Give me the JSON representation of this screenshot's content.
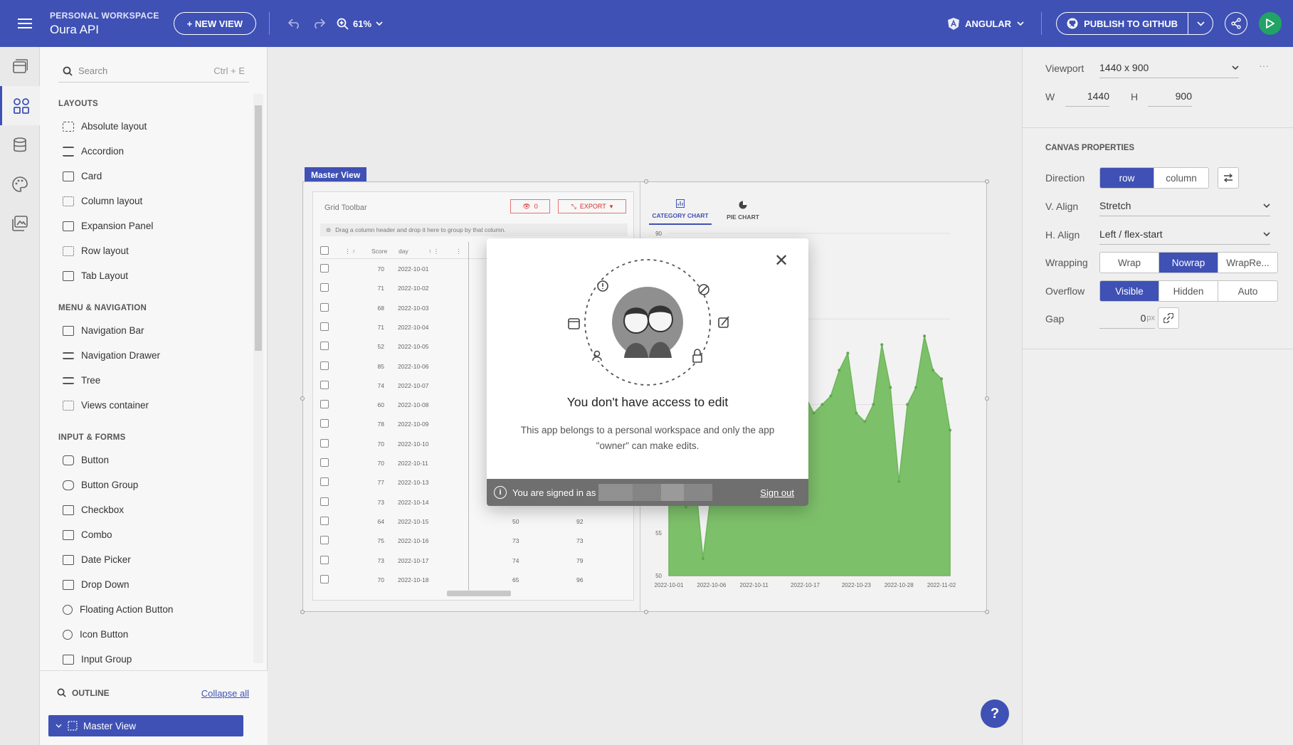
{
  "header": {
    "workspace_label": "PERSONAL WORKSPACE",
    "app_name": "Oura API",
    "new_view_label": "+ NEW VIEW",
    "zoom": "61%",
    "framework": "ANGULAR",
    "publish_label": "PUBLISH TO GITHUB"
  },
  "toolbox": {
    "search_placeholder": "Search",
    "search_shortcut": "Ctrl + E",
    "sections": [
      {
        "title": "LAYOUTS",
        "items": [
          "Absolute layout",
          "Accordion",
          "Card",
          "Column layout",
          "Expansion Panel",
          "Row layout",
          "Tab Layout"
        ]
      },
      {
        "title": "MENU & NAVIGATION",
        "items": [
          "Navigation Bar",
          "Navigation Drawer",
          "Tree",
          "Views container"
        ]
      },
      {
        "title": "INPUT & FORMS",
        "items": [
          "Button",
          "Button Group",
          "Checkbox",
          "Combo",
          "Date Picker",
          "Drop Down",
          "Floating Action Button",
          "Icon Button",
          "Input Group"
        ]
      }
    ],
    "outline_label": "OUTLINE",
    "collapse_all": "Collapse all",
    "outline_item": "Master View"
  },
  "canvas": {
    "master_view_tag": "Master View",
    "grid": {
      "toolbar_title": "Grid Toolbar",
      "hidden_count": "0",
      "export_label": "EXPORT",
      "group_hint": "Drag a column header and drop it here to group by that column.",
      "col_score": "Score",
      "col_day": "day",
      "rows": [
        {
          "score": "70",
          "day": "2022-10-01"
        },
        {
          "score": "71",
          "day": "2022-10-02"
        },
        {
          "score": "68",
          "day": "2022-10-03"
        },
        {
          "score": "71",
          "day": "2022-10-04"
        },
        {
          "score": "52",
          "day": "2022-10-05"
        },
        {
          "score": "85",
          "day": "2022-10-06"
        },
        {
          "score": "74",
          "day": "2022-10-07"
        },
        {
          "score": "60",
          "day": "2022-10-08"
        },
        {
          "score": "78",
          "day": "2022-10-09"
        },
        {
          "score": "70",
          "day": "2022-10-10"
        },
        {
          "score": "70",
          "day": "2022-10-11"
        },
        {
          "score": "77",
          "day": "2022-10-13"
        },
        {
          "score": "73",
          "day": "2022-10-14"
        },
        {
          "score": "64",
          "day": "2022-10-15",
          "c3": "50",
          "c4": "92"
        },
        {
          "score": "75",
          "day": "2022-10-16",
          "c3": "73",
          "c4": "73"
        },
        {
          "score": "73",
          "day": "2022-10-17",
          "c3": "74",
          "c4": "79"
        },
        {
          "score": "70",
          "day": "2022-10-18",
          "c3": "65",
          "c4": "96"
        }
      ]
    },
    "chart_tabs": [
      "CATEGORY CHART",
      "PIE CHART"
    ]
  },
  "chart_data": {
    "type": "area",
    "x": [
      "2022-10-01",
      "2022-10-06",
      "2022-10-11",
      "2022-10-17",
      "2022-10-23",
      "2022-10-28",
      "2022-11-02"
    ],
    "y_ticks": [
      "90",
      "55",
      "50"
    ],
    "ylim": [
      50,
      90
    ],
    "color": "#7dc06a",
    "points": [
      {
        "x": "2022-10-01",
        "y": 62
      },
      {
        "x": "2022-10-02",
        "y": 60
      },
      {
        "x": "2022-10-03",
        "y": 58
      },
      {
        "x": "2022-10-04",
        "y": 62
      },
      {
        "x": "2022-10-05",
        "y": 52
      },
      {
        "x": "2022-10-06",
        "y": 60
      },
      {
        "x": "2022-10-09",
        "y": 64
      },
      {
        "x": "2022-10-12",
        "y": 66
      },
      {
        "x": "2022-10-15",
        "y": 68
      },
      {
        "x": "2022-10-17",
        "y": 71
      },
      {
        "x": "2022-10-18",
        "y": 69
      },
      {
        "x": "2022-10-19",
        "y": 70
      },
      {
        "x": "2022-10-20",
        "y": 71
      },
      {
        "x": "2022-10-21",
        "y": 74
      },
      {
        "x": "2022-10-22",
        "y": 76
      },
      {
        "x": "2022-10-23",
        "y": 69
      },
      {
        "x": "2022-10-24",
        "y": 68
      },
      {
        "x": "2022-10-25",
        "y": 70
      },
      {
        "x": "2022-10-26",
        "y": 77
      },
      {
        "x": "2022-10-27",
        "y": 72
      },
      {
        "x": "2022-10-28",
        "y": 61
      },
      {
        "x": "2022-10-29",
        "y": 70
      },
      {
        "x": "2022-10-30",
        "y": 72
      },
      {
        "x": "2022-10-31",
        "y": 78
      },
      {
        "x": "2022-11-01",
        "y": 74
      },
      {
        "x": "2022-11-02",
        "y": 73
      },
      {
        "x": "2022-11-03",
        "y": 67
      }
    ]
  },
  "dialog": {
    "title": "You don't have access to edit",
    "text": "This app belongs to a personal workspace and only the app \"owner\" can make edits.",
    "signed_in": "You are signed in as",
    "sign_out": "Sign out"
  },
  "props": {
    "viewport_label": "Viewport",
    "viewport_value": "1440 x 900",
    "w_label": "W",
    "w_value": "1440",
    "h_label": "H",
    "h_value": "900",
    "canvas_title": "CANVAS PROPERTIES",
    "direction_label": "Direction",
    "direction_options": [
      "row",
      "column"
    ],
    "valign_label": "V. Align",
    "valign_value": "Stretch",
    "halign_label": "H. Align",
    "halign_value": "Left / flex-start",
    "wrapping_label": "Wrapping",
    "wrapping_options": [
      "Wrap",
      "Nowrap",
      "WrapRe..."
    ],
    "overflow_label": "Overflow",
    "overflow_options": [
      "Visible",
      "Hidden",
      "Auto"
    ],
    "gap_label": "Gap",
    "gap_value": "0",
    "gap_unit": "px"
  },
  "help_label": "?"
}
